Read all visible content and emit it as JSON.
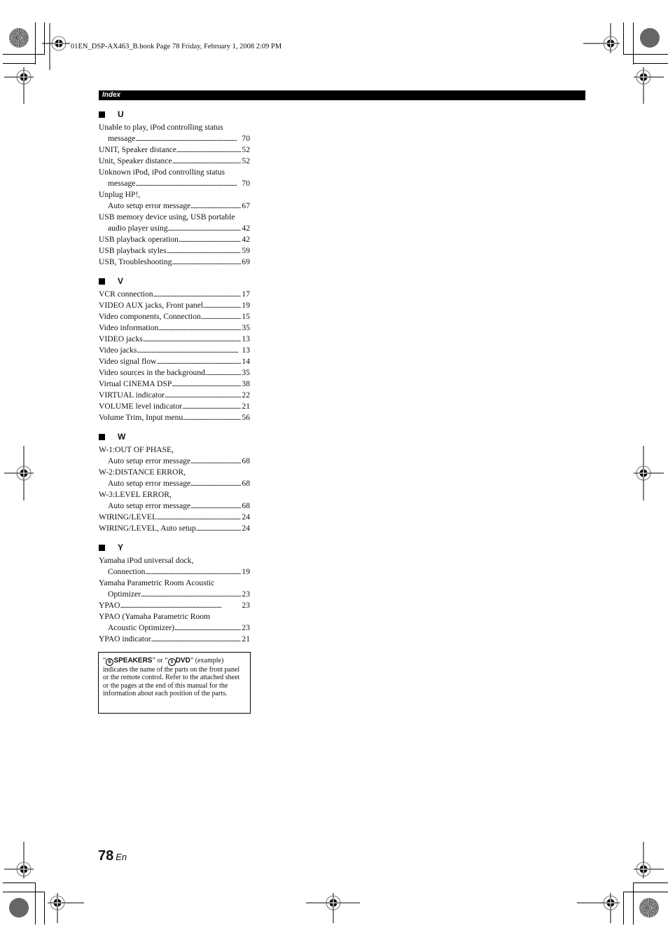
{
  "file_info": "01EN_DSP-AX463_B.book  Page 78  Friday, February 1, 2008  2:09 PM",
  "header": {
    "section_title": "Index"
  },
  "sections": [
    {
      "letter": "U",
      "entries": [
        {
          "lines": [
            "Unable to play, iPod controlling status",
            "message"
          ],
          "page": "70"
        },
        {
          "lines": [
            "UNIT, Speaker distance"
          ],
          "page": "52"
        },
        {
          "lines": [
            "Unit, Speaker distance"
          ],
          "page": "52"
        },
        {
          "lines": [
            "Unknown iPod, iPod controlling status",
            "message"
          ],
          "page": "70"
        },
        {
          "lines": [
            "Unplug HP!,",
            "Auto setup error message"
          ],
          "page": "67"
        },
        {
          "lines": [
            "USB memory device using, USB portable",
            "audio player using"
          ],
          "page": "42"
        },
        {
          "lines": [
            "USB playback operation"
          ],
          "page": "42"
        },
        {
          "lines": [
            "USB playback styles"
          ],
          "page": "59"
        },
        {
          "lines": [
            "USB, Troubleshooting"
          ],
          "page": "69"
        }
      ]
    },
    {
      "letter": "V",
      "entries": [
        {
          "lines": [
            "VCR connection"
          ],
          "page": "17"
        },
        {
          "lines": [
            "VIDEO AUX jacks, Front panel"
          ],
          "page": "19"
        },
        {
          "lines": [
            "Video components, Connection"
          ],
          "page": "15"
        },
        {
          "lines": [
            "Video information"
          ],
          "page": "35"
        },
        {
          "lines": [
            "VIDEO jacks"
          ],
          "page": "13"
        },
        {
          "lines": [
            "Video jacks"
          ],
          "page": "13"
        },
        {
          "lines": [
            "Video signal flow"
          ],
          "page": "14"
        },
        {
          "lines": [
            "Video sources in the background"
          ],
          "page": "35"
        },
        {
          "lines": [
            "Virtual CINEMA DSP"
          ],
          "page": "38"
        },
        {
          "lines": [
            "VIRTUAL indicator"
          ],
          "page": "22"
        },
        {
          "lines": [
            "VOLUME level indicator"
          ],
          "page": "21"
        },
        {
          "lines": [
            "Volume Trim, Input menu"
          ],
          "page": "56"
        }
      ]
    },
    {
      "letter": "W",
      "entries": [
        {
          "lines": [
            "W-1:OUT OF PHASE,",
            "Auto setup error message"
          ],
          "page": "68"
        },
        {
          "lines": [
            "W-2:DISTANCE ERROR,",
            "Auto setup error message"
          ],
          "page": "68"
        },
        {
          "lines": [
            "W-3:LEVEL ERROR,",
            "Auto setup error message"
          ],
          "page": "68"
        },
        {
          "lines": [
            "WIRING/LEVEL"
          ],
          "page": "24"
        },
        {
          "lines": [
            "WIRING/LEVEL, Auto setup"
          ],
          "page": "24"
        }
      ]
    },
    {
      "letter": "Y",
      "entries": [
        {
          "lines": [
            "Yamaha iPod universal dock,",
            "Connection"
          ],
          "page": "19"
        },
        {
          "lines": [
            "Yamaha Parametric Room Acoustic",
            "Optimizer"
          ],
          "page": "23"
        },
        {
          "lines": [
            "YPAO"
          ],
          "page": "23"
        },
        {
          "lines": [
            "YPAO (Yamaha Parametric Room",
            "Acoustic Optimizer)"
          ],
          "page": "23"
        },
        {
          "lines": [
            "YPAO indicator"
          ],
          "page": "21"
        }
      ]
    }
  ],
  "note": {
    "example1_symbol": "E",
    "example1_label": "SPEAKERS",
    "connector": "” or “",
    "example2_symbol": "3",
    "example2_label": "DVD",
    "example_suffix": "” (example)",
    "body": "indicates the name of the parts on the front panel or the remote control. Refer to the attached sheet or the pages at the end of this manual for the information about each position of the parts."
  },
  "footer": {
    "page_number": "78",
    "language": "En"
  }
}
